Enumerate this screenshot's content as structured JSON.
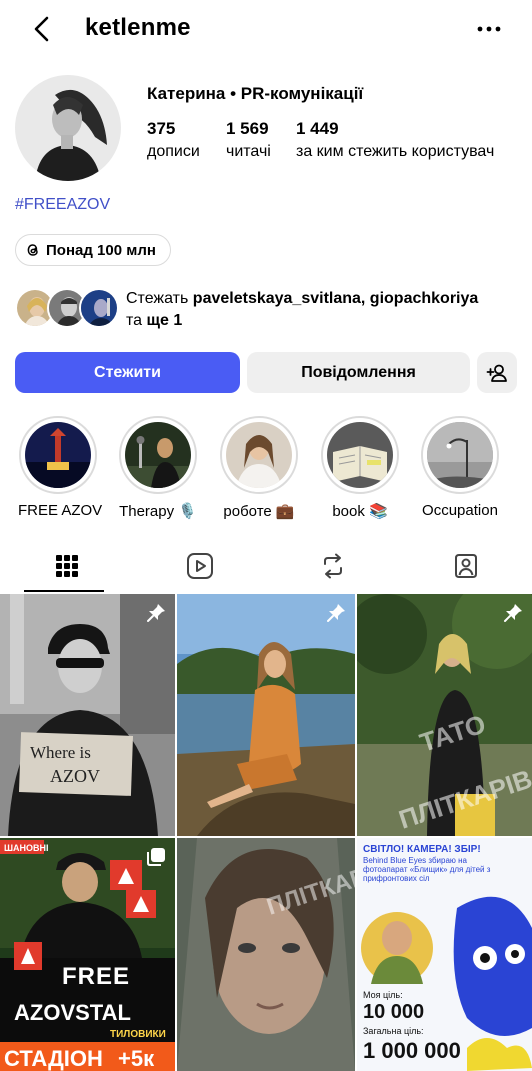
{
  "header": {
    "username": "ketlenme"
  },
  "profile": {
    "name": "Катерина • PR-комунікації",
    "stats": [
      {
        "value": "375",
        "label": "дописи"
      },
      {
        "value": "1 569",
        "label": "читачі"
      },
      {
        "value": "1 449",
        "label": "за ким стежить користувач"
      }
    ],
    "hashtag": "#FREEAZOV",
    "threads_badge": "Понад 100 млн",
    "mutual": {
      "prefix": "Стежать",
      "names": "paveletskaya_svitlana, giopachkoriya",
      "joiner": "та",
      "more": "ще 1"
    }
  },
  "buttons": {
    "follow": "Стежити",
    "message": "Повідомлення"
  },
  "highlights": [
    {
      "label": "FREE AZOV"
    },
    {
      "label": "Therapy 🎙️"
    },
    {
      "label": "роботе 💼"
    },
    {
      "label": "book 📚"
    },
    {
      "label": "Occupation"
    }
  ],
  "tabs": [
    {
      "icon": "grid-icon",
      "active": true
    },
    {
      "icon": "reels-icon",
      "active": false
    },
    {
      "icon": "repost-icon",
      "active": false
    },
    {
      "icon": "tagged-icon",
      "active": false
    }
  ],
  "posts": {
    "sign_text_1": "Where is",
    "sign_text_2": "AZOV",
    "watermark_1": "ТАТО",
    "watermark_2": "ПЛІТКАРІВ",
    "post4_header": "ШАНОВНІ",
    "post4_line1": "FREE",
    "post4_line2": "AZOVSTAL",
    "post4_bottom1": "ТИЛОВИКИ",
    "post4_bottom2": "СТАДІОН",
    "post4_bottom3": "+5к",
    "post6_title": "СВІТЛО! КАМЕРА! ЗБІР!",
    "post6_sub": "Behind Blue Eyes збираю на фотоапарат «Блищик» для дітей з прифронтових сіл",
    "post6_goal_label": "Моя ціль:",
    "post6_goal": "10 000",
    "post6_total_label": "Загальна ціль:",
    "post6_total": "1 000 000"
  }
}
